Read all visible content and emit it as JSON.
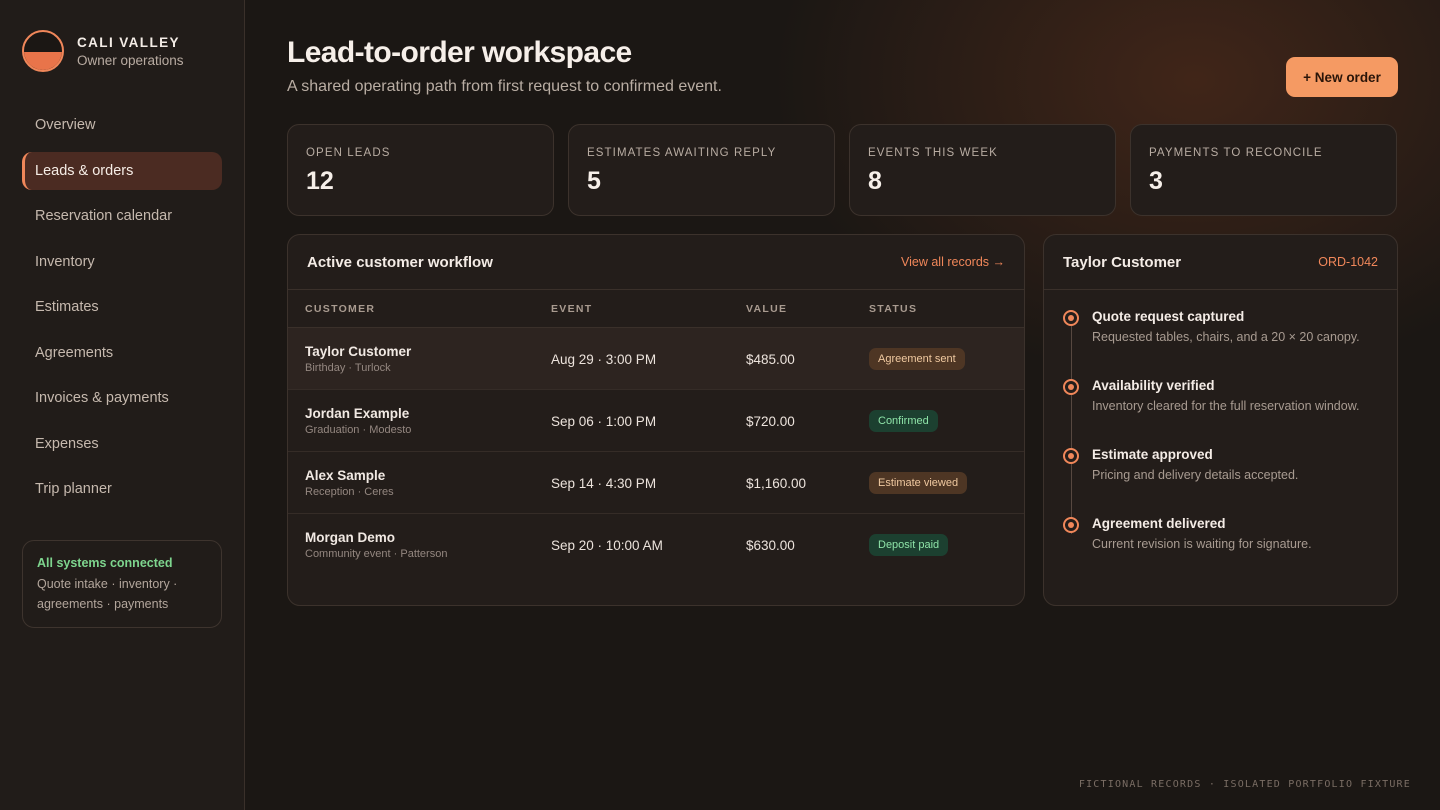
{
  "brand": {
    "name": "CALI VALLEY",
    "subtitle": "Owner operations",
    "logo_icon": "half-sun-logo"
  },
  "nav": [
    {
      "label": "Overview",
      "active": false
    },
    {
      "label": "Leads & orders",
      "active": true
    },
    {
      "label": "Reservation calendar",
      "active": false
    },
    {
      "label": "Inventory",
      "active": false
    },
    {
      "label": "Estimates",
      "active": false
    },
    {
      "label": "Agreements",
      "active": false
    },
    {
      "label": "Invoices & payments",
      "active": false
    },
    {
      "label": "Expenses",
      "active": false
    },
    {
      "label": "Trip planner",
      "active": false
    }
  ],
  "system_status": {
    "title": "All systems connected",
    "description": "Quote intake · inventory · agreements · payments"
  },
  "header": {
    "title": "Lead-to-order workspace",
    "subtitle": "A shared operating path from first request to confirmed event.",
    "new_order_label": "+ New order"
  },
  "kpis": [
    {
      "label": "OPEN LEADS",
      "value": "12"
    },
    {
      "label": "ESTIMATES AWAITING REPLY",
      "value": "5"
    },
    {
      "label": "EVENTS THIS WEEK",
      "value": "8"
    },
    {
      "label": "PAYMENTS TO RECONCILE",
      "value": "3"
    }
  ],
  "workflow": {
    "title": "Active customer workflow",
    "view_all_label": "View all records →",
    "columns": [
      "CUSTOMER",
      "EVENT",
      "VALUE",
      "STATUS"
    ],
    "rows": [
      {
        "name": "Taylor Customer",
        "meta": "Birthday · Turlock",
        "event": "Aug 29 · 3:00 PM",
        "value": "$485.00",
        "status": "Agreement sent"
      },
      {
        "name": "Jordan Example",
        "meta": "Graduation · Modesto",
        "event": "Sep 06 · 1:00 PM",
        "value": "$720.00",
        "status": "Confirmed"
      },
      {
        "name": "Alex Sample",
        "meta": "Reception · Ceres",
        "event": "Sep 14 · 4:30 PM",
        "value": "$1,160.00",
        "status": "Estimate viewed"
      },
      {
        "name": "Morgan Demo",
        "meta": "Community event · Patterson",
        "event": "Sep 20 · 10:00 AM",
        "value": "$630.00",
        "status": "Deposit paid"
      }
    ]
  },
  "detail": {
    "customer": "Taylor Customer",
    "order_id": "ORD-1042",
    "steps": [
      {
        "title": "Quote request captured",
        "description": "Requested tables, chairs, and a 20 × 20 canopy."
      },
      {
        "title": "Availability verified",
        "description": "Inventory cleared for the full reservation window."
      },
      {
        "title": "Estimate approved",
        "description": "Pricing and delivery details accepted."
      },
      {
        "title": "Agreement delivered",
        "description": "Current revision is waiting for signature."
      }
    ]
  },
  "footer_note": "FICTIONAL RECORDS · ISOLATED PORTFOLIO FIXTURE",
  "colors": {
    "accent": "#f0875a",
    "button": "#f59a63",
    "success": "#7ed58e",
    "background": "#1b1714"
  }
}
